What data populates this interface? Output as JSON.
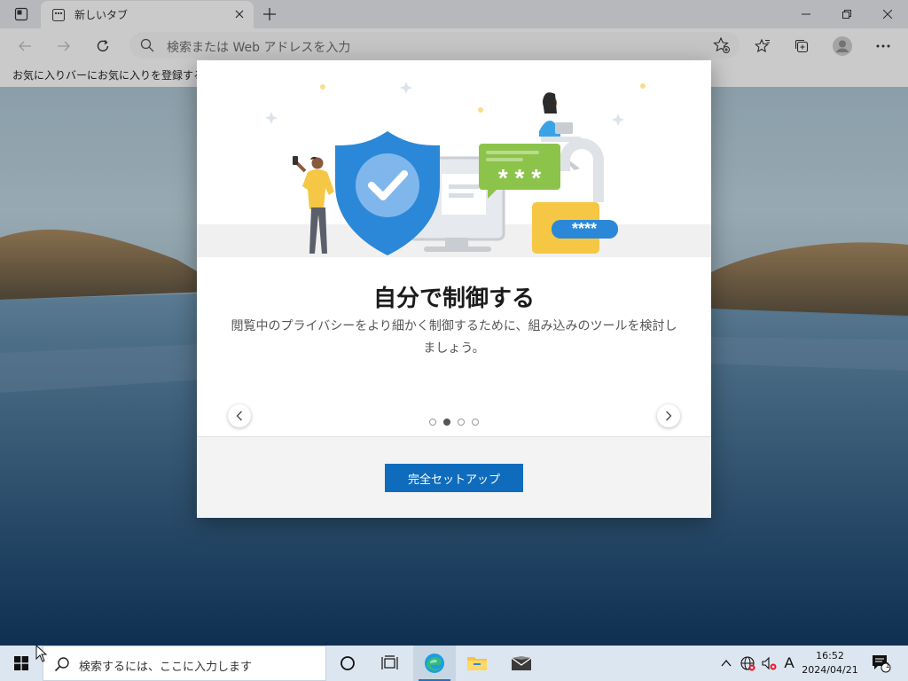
{
  "browser": {
    "tab_title": "新しいタブ",
    "address_placeholder": "検索または Web アドレスを入力",
    "favorites_bar_text": "お気に入りバーにお気に入りを登録すると、簡"
  },
  "modal": {
    "title": "自分で制御する",
    "description": "閲覧中のプライバシーをより細かく制御するために、組み込みのツールを検討しましょう。",
    "password_mask": "****",
    "card_mask": "* * *",
    "pager": {
      "total": 4,
      "active": 2
    },
    "setup_button": "完全セットアップ"
  },
  "taskbar": {
    "search_placeholder": "検索するには、ここに入力します",
    "ime_indicator": "A",
    "time": "16:52",
    "date": "2024/04/21",
    "notification_count": "1"
  },
  "colors": {
    "accent": "#0f6cbd",
    "shield": "#2b88d8",
    "lock": "#f5c744",
    "message_card": "#8cc34a"
  }
}
